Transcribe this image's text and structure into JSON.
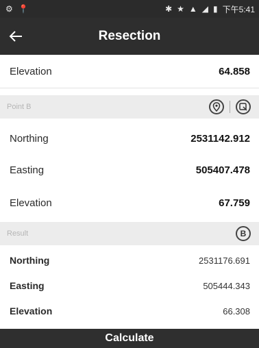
{
  "statusbar": {
    "time": "下午5:41"
  },
  "appbar": {
    "title": "Resection"
  },
  "pointA": {
    "elevation_label": "Elevation",
    "elevation_value": "64.858"
  },
  "pointB": {
    "section_title": "Point B",
    "northing_label": "Northing",
    "northing_value": "2531142.912",
    "easting_label": "Easting",
    "easting_value": "505407.478",
    "elevation_label": "Elevation",
    "elevation_value": "67.759"
  },
  "result": {
    "section_title": "Result",
    "b_button": "B",
    "northing_label": "Northing",
    "northing_value": "2531176.691",
    "easting_label": "Easting",
    "easting_value": "505444.343",
    "elevation_label": "Elevation",
    "elevation_value": "66.308"
  },
  "actions": {
    "calculate_label": "Calculate"
  },
  "icons": {
    "status_left": [
      "gear-icon",
      "location-pin-icon"
    ],
    "status_right": [
      "bluetooth-icon",
      "star-icon",
      "wifi-icon",
      "signal-icon",
      "battery-icon"
    ],
    "back": "back-arrow-icon",
    "pointB_tools": [
      "map-pin-icon",
      "select-point-icon"
    ]
  }
}
